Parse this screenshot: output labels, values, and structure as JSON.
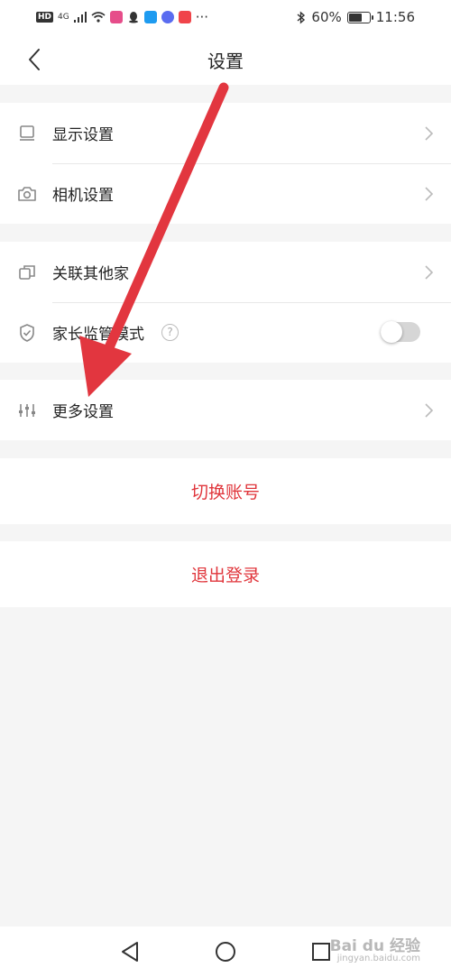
{
  "status_bar": {
    "left_badges": [
      "HD",
      "4G"
    ],
    "more": "···",
    "battery": "60%",
    "battery_level": 0.6,
    "time": "11:56"
  },
  "header": {
    "title": "设置"
  },
  "groups": [
    {
      "items": [
        {
          "label": "显示设置",
          "icon": "display-icon"
        },
        {
          "label": "相机设置",
          "icon": "camera-icon"
        }
      ]
    },
    {
      "items": [
        {
          "label": "关联其他家",
          "icon": "link-family-icon"
        },
        {
          "label": "家长监管模式",
          "icon": "shield-icon",
          "help": "?",
          "toggle_on": false
        }
      ]
    },
    {
      "items": [
        {
          "label": "更多设置",
          "icon": "sliders-icon"
        }
      ]
    }
  ],
  "actions": {
    "switch_account": "切换账号",
    "logout": "退出登录",
    "accent_color": "#e0363c"
  },
  "watermark": {
    "brand": "Bai du 经验",
    "url": "jingyan.baidu.com"
  }
}
